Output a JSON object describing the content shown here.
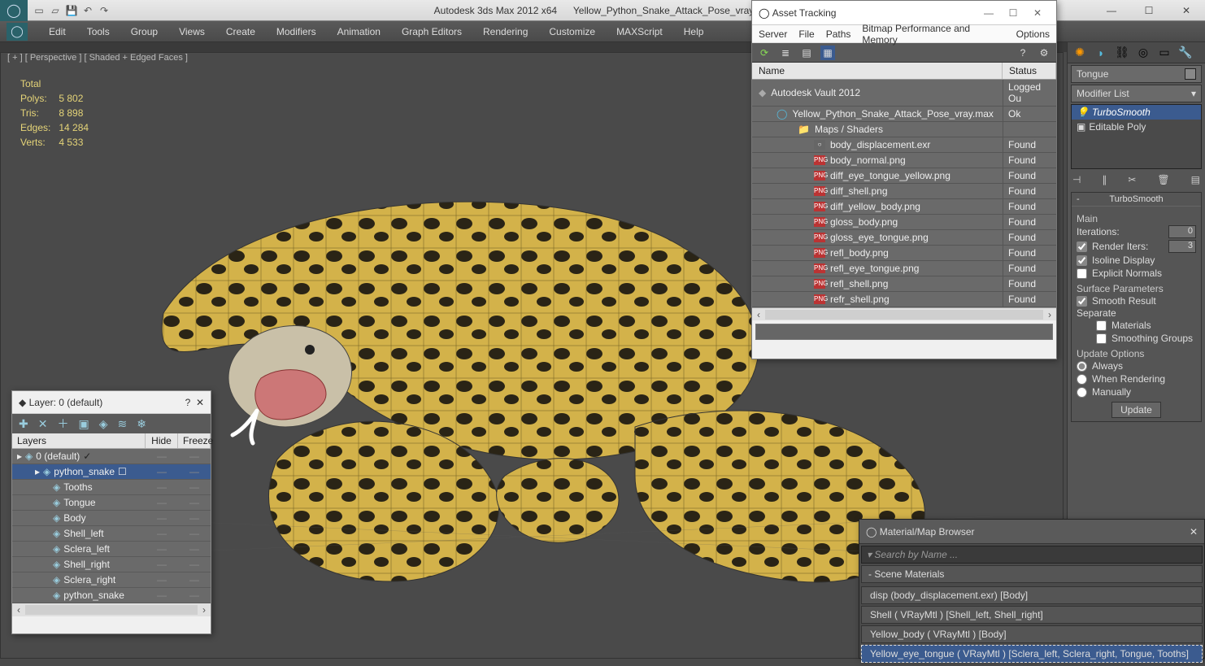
{
  "titlebar": {
    "app": "Autodesk 3ds Max  2012 x64",
    "file": "Yellow_Python_Snake_Attack_Pose_vray.max"
  },
  "menubar": [
    "Edit",
    "Tools",
    "Group",
    "Views",
    "Create",
    "Modifiers",
    "Animation",
    "Graph Editors",
    "Rendering",
    "Customize",
    "MAXScript",
    "Help"
  ],
  "viewport": {
    "label": "[ + ] [ Perspective ]  [ Shaded + Edged Faces ]",
    "stats": {
      "total": "Total",
      "polys_l": "Polys:",
      "polys_v": "5 802",
      "tris_l": "Tris:",
      "tris_v": "8 898",
      "edges_l": "Edges:",
      "edges_v": "14 284",
      "verts_l": "Verts:",
      "verts_v": "4 533"
    }
  },
  "asset": {
    "title": "Asset Tracking",
    "menu": [
      "Server",
      "File",
      "Paths",
      "Bitmap Performance and Memory",
      "Options"
    ],
    "cols": {
      "name": "Name",
      "status": "Status"
    },
    "rows": [
      {
        "indent": 0,
        "icon": "vault",
        "name": "Autodesk Vault 2012",
        "status": "Logged Ou"
      },
      {
        "indent": 1,
        "icon": "max",
        "name": "Yellow_Python_Snake_Attack_Pose_vray.max",
        "status": "Ok"
      },
      {
        "indent": 2,
        "icon": "folder",
        "name": "Maps / Shaders",
        "status": ""
      },
      {
        "indent": 3,
        "icon": "exr",
        "name": "body_displacement.exr",
        "status": "Found"
      },
      {
        "indent": 3,
        "icon": "png",
        "name": "body_normal.png",
        "status": "Found"
      },
      {
        "indent": 3,
        "icon": "png",
        "name": "diff_eye_tongue_yellow.png",
        "status": "Found"
      },
      {
        "indent": 3,
        "icon": "png",
        "name": "diff_shell.png",
        "status": "Found"
      },
      {
        "indent": 3,
        "icon": "png",
        "name": "diff_yellow_body.png",
        "status": "Found"
      },
      {
        "indent": 3,
        "icon": "png",
        "name": "gloss_body.png",
        "status": "Found"
      },
      {
        "indent": 3,
        "icon": "png",
        "name": "gloss_eye_tongue.png",
        "status": "Found"
      },
      {
        "indent": 3,
        "icon": "png",
        "name": "refl_body.png",
        "status": "Found"
      },
      {
        "indent": 3,
        "icon": "png",
        "name": "refl_eye_tongue.png",
        "status": "Found"
      },
      {
        "indent": 3,
        "icon": "png",
        "name": "refl_shell.png",
        "status": "Found"
      },
      {
        "indent": 3,
        "icon": "png",
        "name": "refr_shell.png",
        "status": "Found"
      }
    ]
  },
  "layer": {
    "title": "Layer: 0 (default)",
    "cols": {
      "layers": "Layers",
      "hide": "Hide",
      "freeze": "Freeze"
    },
    "rows": [
      {
        "indent": 0,
        "name": "0 (default)",
        "check": true,
        "sel": false
      },
      {
        "indent": 1,
        "name": "python_snake",
        "check": false,
        "sel": true
      },
      {
        "indent": 2,
        "name": "Tooths"
      },
      {
        "indent": 2,
        "name": "Tongue"
      },
      {
        "indent": 2,
        "name": "Body"
      },
      {
        "indent": 2,
        "name": "Shell_left"
      },
      {
        "indent": 2,
        "name": "Sclera_left"
      },
      {
        "indent": 2,
        "name": "Shell_right"
      },
      {
        "indent": 2,
        "name": "Sclera_right"
      },
      {
        "indent": 2,
        "name": "python_snake"
      }
    ]
  },
  "cmd": {
    "obj_name": "Tongue",
    "mod_list": "Modifier List",
    "stack": [
      {
        "name": "TurboSmooth",
        "sel": true
      },
      {
        "name": "Editable Poly",
        "sel": false
      }
    ],
    "rollout_title": "TurboSmooth",
    "main_label": "Main",
    "iterations_label": "Iterations:",
    "iterations_value": "0",
    "render_iters_label": "Render Iters:",
    "render_iters_value": "3",
    "render_iters_checked": true,
    "isoline_label": "Isoline Display",
    "isoline_checked": true,
    "explicit_label": "Explicit Normals",
    "surface_label": "Surface Parameters",
    "smooth_result_label": "Smooth Result",
    "smooth_result_checked": true,
    "separate_label": "Separate",
    "sep_materials": "Materials",
    "sep_groups": "Smoothing Groups",
    "update_label": "Update Options",
    "opt_always": "Always",
    "opt_render": "When Rendering",
    "opt_manual": "Manually",
    "update_btn": "Update"
  },
  "material": {
    "title": "Material/Map Browser",
    "search_placeholder": "Search by Name ...",
    "section": "- Scene Materials",
    "items": [
      {
        "label": "disp (body_displacement.exr)  [Body]",
        "sel": false
      },
      {
        "label": "Shell  ( VRayMtl )  [Shell_left, Shell_right]",
        "sel": false
      },
      {
        "label": "Yellow_body  ( VRayMtl )  [Body]",
        "sel": false
      },
      {
        "label": "Yellow_eye_tongue  ( VRayMtl )  [Sclera_left, Sclera_right, Tongue, Tooths]",
        "sel": true
      }
    ]
  }
}
